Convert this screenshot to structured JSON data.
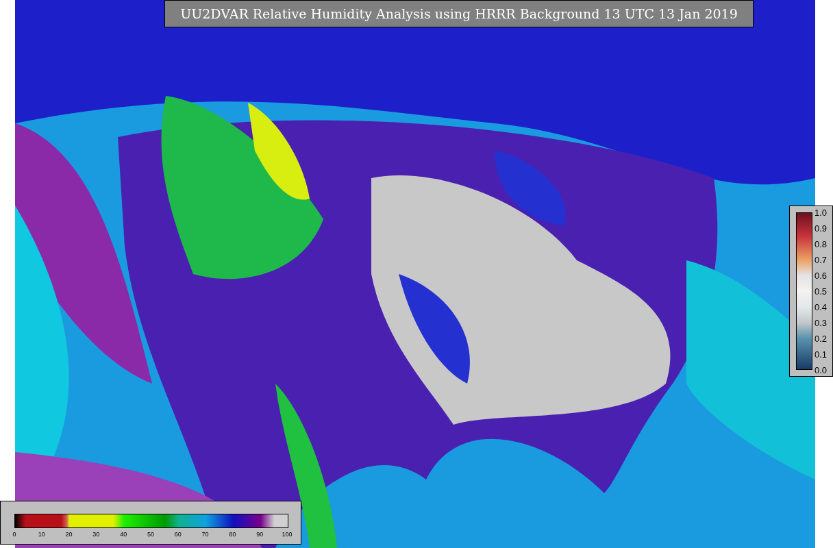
{
  "title": "UU2DVAR Relative Humidity Analysis using HRRR Background 13 UTC 13 Jan 2019",
  "right_colorbar": {
    "ticks": [
      "1.0",
      "0.9",
      "0.8",
      "0.7",
      "0.6",
      "0.5",
      "0.4",
      "0.3",
      "0.2",
      "0.1",
      "0.0"
    ]
  },
  "bottom_colorbar": {
    "ticks": [
      "0",
      "10",
      "20",
      "30",
      "40",
      "50",
      "60",
      "70",
      "80",
      "90",
      "100"
    ]
  }
}
